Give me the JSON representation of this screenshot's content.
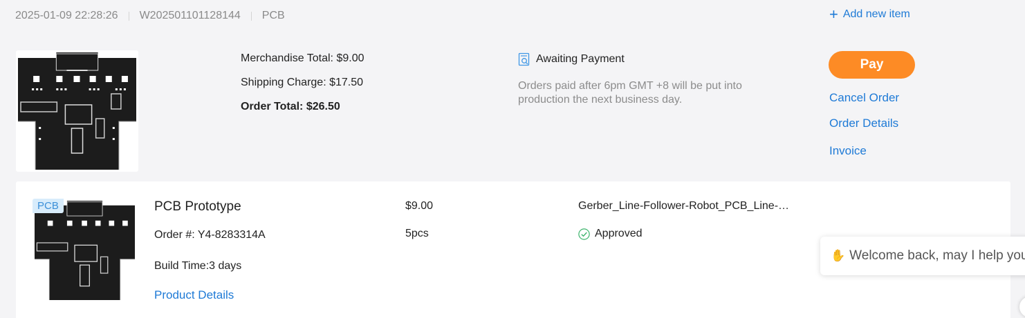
{
  "order": {
    "datetime": "2025-01-09 22:28:26",
    "order_id": "W202501101128144",
    "type": "PCB",
    "add_new_label": "Add new item",
    "totals": {
      "merchandise": "Merchandise Total: $9.00",
      "shipping": "Shipping Charge: $17.50",
      "order_total": "Order Total: $26.50"
    },
    "status": {
      "label": "Awaiting Payment",
      "note": "Orders paid after 6pm GMT +8 will be put into production the next business day."
    },
    "actions": {
      "pay": "Pay",
      "cancel": "Cancel Order",
      "details": "Order Details",
      "invoice": "Invoice"
    }
  },
  "item": {
    "tag": "PCB",
    "title": "PCB Prototype",
    "order_no": "Order #: Y4-8283314A",
    "build_time": "Build Time:3 days",
    "product_details": "Product Details",
    "price": "$9.00",
    "quantity": "5pcs",
    "filename": "Gerber_Line-Follower-Robot_PCB_Line-Follower-Robot.zip",
    "approval": "Approved"
  },
  "chat": {
    "message": "Welcome back, may I help you?"
  },
  "colors": {
    "accent_blue": "#1e7ad6",
    "pay_orange": "#fd8b25",
    "approved_green": "#3bb36b"
  },
  "icons": [
    "plus-icon",
    "awaiting-payment-icon",
    "approved-check-icon",
    "waving-hand-icon"
  ]
}
